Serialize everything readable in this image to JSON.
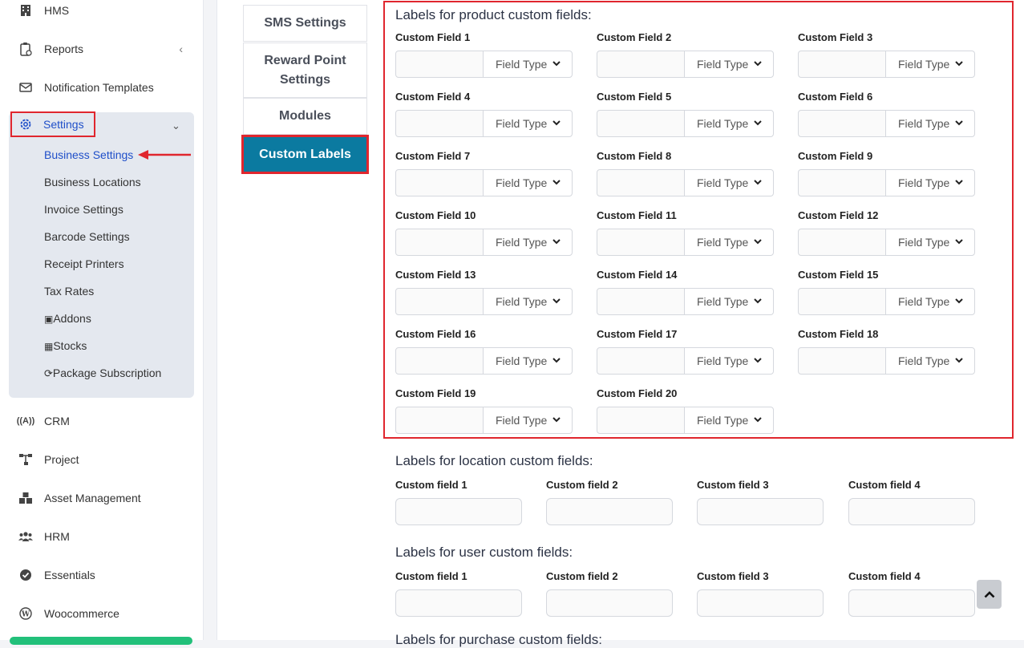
{
  "sidebar": {
    "items_top": [
      {
        "label": "HMS",
        "icon": "building-icon"
      },
      {
        "label": "Reports",
        "icon": "clipboard-icon"
      },
      {
        "label": "Notification Templates",
        "icon": "envelope-icon"
      }
    ],
    "settings": {
      "label": "Settings",
      "icon": "gear-icon",
      "sub_items": [
        "Business Settings",
        "Business Locations",
        "Invoice Settings",
        "Barcode Settings",
        "Receipt Printers",
        "Tax Rates",
        "Addons",
        "Stocks",
        "Package Subscription"
      ]
    },
    "items_bottom": [
      {
        "label": "CRM",
        "icon": "broadcast-icon"
      },
      {
        "label": "Project",
        "icon": "sitemap-icon"
      },
      {
        "label": "Asset Management",
        "icon": "boxes-icon"
      },
      {
        "label": "HRM",
        "icon": "users-icon"
      },
      {
        "label": "Essentials",
        "icon": "check-circle-icon"
      },
      {
        "label": "Woocommerce",
        "icon": "wordpress-icon"
      }
    ]
  },
  "tabs": [
    "SMS Settings",
    "Reward Point Settings",
    "Modules",
    "Custom Labels"
  ],
  "product_section": {
    "title": "Labels for product custom fields:",
    "type_placeholder": "Field Type",
    "fields": [
      "Custom Field 1",
      "Custom Field 2",
      "Custom Field 3",
      "Custom Field 4",
      "Custom Field 5",
      "Custom Field 6",
      "Custom Field 7",
      "Custom Field 8",
      "Custom Field 9",
      "Custom Field 10",
      "Custom Field 11",
      "Custom Field 12",
      "Custom Field 13",
      "Custom Field 14",
      "Custom Field 15",
      "Custom Field 16",
      "Custom Field 17",
      "Custom Field 18",
      "Custom Field 19",
      "Custom Field 20"
    ]
  },
  "location_section": {
    "title": "Labels for location custom fields:",
    "fields": [
      "Custom field 1",
      "Custom field 2",
      "Custom field 3",
      "Custom field 4"
    ]
  },
  "user_section": {
    "title": "Labels for user custom fields:",
    "fields": [
      "Custom field 1",
      "Custom field 2",
      "Custom field 3",
      "Custom field 4"
    ]
  },
  "next_section": {
    "title": "Labels for purchase custom fields:"
  },
  "colors": {
    "accent": "#0b7aa0",
    "highlight": "#e0262e",
    "link": "#1f4fc9"
  }
}
